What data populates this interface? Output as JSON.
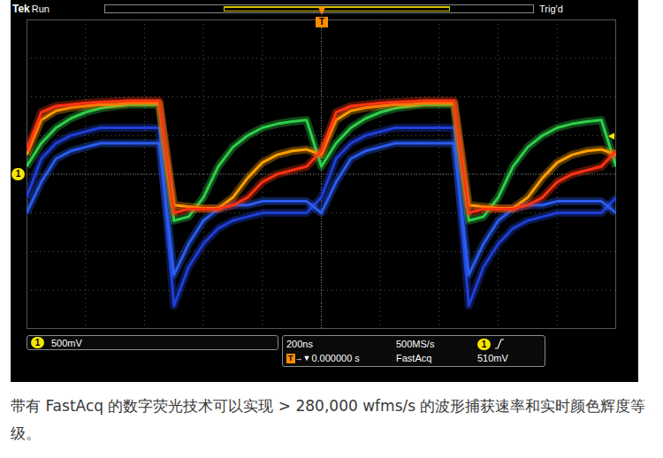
{
  "header": {
    "brand": "Tek",
    "state": "Run",
    "trigger_state": "Trig'd"
  },
  "markers": {
    "channel": "1",
    "trigger": "T"
  },
  "chart": {
    "volts_per_div": 0.5,
    "divisions_x": 10,
    "divisions_y": 8,
    "sample_step_div": 0.25,
    "series": [
      {
        "name": "blue-outer",
        "color": "#1f3fd8",
        "values": [
          -0.3,
          0.2,
          0.4,
          0.5,
          0.55,
          0.6,
          0.6,
          0.6,
          0.6,
          0.6,
          -1.7,
          -1.2,
          -0.9,
          -0.7,
          -0.6,
          -0.55,
          -0.5,
          -0.5,
          -0.5,
          -0.5,
          -0.3,
          0.2,
          0.4,
          0.5,
          0.55,
          0.6,
          0.6,
          0.6,
          0.6,
          0.6,
          -1.7,
          -1.2,
          -0.9,
          -0.7,
          -0.6,
          -0.55,
          -0.5,
          -0.5,
          -0.5,
          -0.5,
          -0.3
        ]
      },
      {
        "name": "blue-inner",
        "color": "#2a5cf0",
        "values": [
          -0.5,
          -0.1,
          0.2,
          0.3,
          0.35,
          0.4,
          0.4,
          0.4,
          0.4,
          0.4,
          -1.3,
          -0.9,
          -0.6,
          -0.45,
          -0.4,
          -0.4,
          -0.35,
          -0.35,
          -0.35,
          -0.35,
          -0.5,
          -0.1,
          0.2,
          0.3,
          0.35,
          0.4,
          0.4,
          0.4,
          0.4,
          0.4,
          -1.3,
          -0.9,
          -0.6,
          -0.45,
          -0.4,
          -0.4,
          -0.35,
          -0.35,
          -0.35,
          -0.35,
          -0.5
        ]
      },
      {
        "name": "green",
        "color": "#2fcf4a",
        "values": [
          0.1,
          0.4,
          0.6,
          0.72,
          0.8,
          0.85,
          0.88,
          0.9,
          0.9,
          0.9,
          -0.6,
          -0.55,
          -0.3,
          0.1,
          0.35,
          0.5,
          0.6,
          0.65,
          0.68,
          0.7,
          0.1,
          0.4,
          0.6,
          0.72,
          0.8,
          0.85,
          0.88,
          0.9,
          0.9,
          0.9,
          -0.6,
          -0.55,
          -0.3,
          0.1,
          0.35,
          0.5,
          0.6,
          0.65,
          0.68,
          0.7,
          0.1
        ]
      },
      {
        "name": "orange",
        "color": "#ff9f00",
        "values": [
          0.25,
          0.7,
          0.82,
          0.86,
          0.88,
          0.9,
          0.9,
          0.92,
          0.92,
          0.92,
          -0.4,
          -0.42,
          -0.44,
          -0.44,
          -0.3,
          -0.05,
          0.15,
          0.25,
          0.3,
          0.32,
          0.25,
          0.7,
          0.82,
          0.86,
          0.88,
          0.9,
          0.9,
          0.92,
          0.92,
          0.92,
          -0.4,
          -0.42,
          -0.44,
          -0.44,
          -0.3,
          -0.05,
          0.15,
          0.25,
          0.3,
          0.32,
          0.25
        ]
      },
      {
        "name": "red",
        "color": "#ff3412",
        "values": [
          0.3,
          0.8,
          0.88,
          0.9,
          0.92,
          0.93,
          0.94,
          0.95,
          0.95,
          0.95,
          -0.5,
          -0.45,
          -0.45,
          -0.45,
          -0.4,
          -0.3,
          -0.1,
          0.0,
          0.05,
          0.1,
          0.3,
          0.8,
          0.88,
          0.9,
          0.92,
          0.93,
          0.94,
          0.95,
          0.95,
          0.95,
          -0.5,
          -0.45,
          -0.45,
          -0.45,
          -0.4,
          -0.3,
          -0.1,
          0.0,
          0.05,
          0.1,
          0.3
        ]
      }
    ]
  },
  "readouts": {
    "channel": {
      "id": "1",
      "scale": "500mV"
    },
    "timebase": "200ns",
    "sample_rate": "500MS/s",
    "trigger": {
      "source": "1",
      "level": "510mV"
    },
    "delay_marker": "T",
    "delay_arrow": "→▼",
    "delay": "0.000000 s",
    "mode": "FastAcq"
  },
  "caption": "带有 FastAcq 的数字荧光技术可以实现 > 280,000 wfms/s 的波形捕获速率和实时颜色辉度等级。"
}
